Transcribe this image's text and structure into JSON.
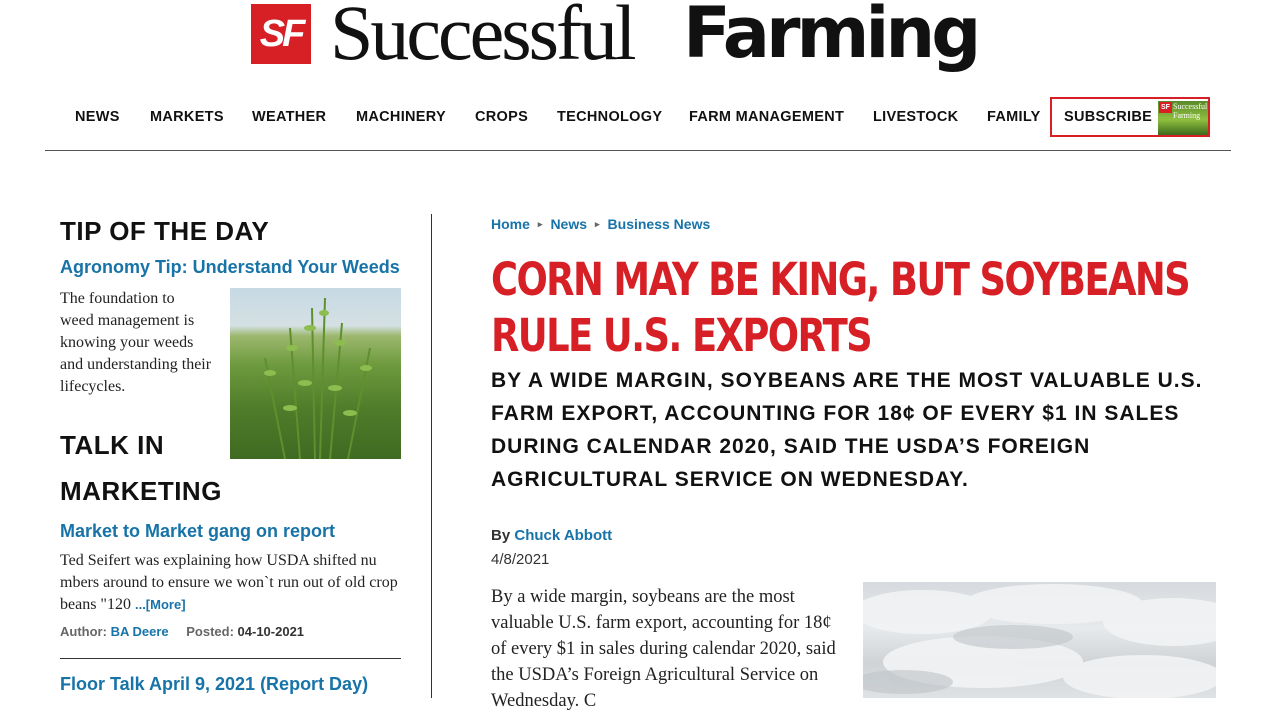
{
  "logo": {
    "badge": "SF",
    "word_light": "Successful",
    "word_bold": "Farming"
  },
  "nav": {
    "items": [
      "NEWS",
      "MARKETS",
      "WEATHER",
      "MACHINERY",
      "CROPS",
      "TECHNOLOGY",
      "FARM MANAGEMENT",
      "LIVESTOCK",
      "FAMILY"
    ],
    "subscribe": "SUBSCRIBE"
  },
  "sidebar": {
    "tip": {
      "heading": "TIP OF THE DAY",
      "link": "Agronomy Tip: Understand Your Weeds",
      "text": "The foundation to weed management is knowing your weeds and understanding their lifecycles."
    },
    "talk": {
      "heading_line1": "TALK IN",
      "heading_line2": "MARKETING",
      "link": "Market to Market gang on report",
      "text": "Ted Seifert was explaining how USDA shifted nu mbers around to ensure we won`t run out of old crop beans \"120 ",
      "more": "...[More]",
      "author_label": "Author:",
      "author": "BA Deere",
      "posted_label": "Posted:",
      "posted": "04-10-2021",
      "next_link": "Floor Talk April 9, 2021 (Report Day)"
    }
  },
  "article": {
    "breadcrumb": [
      "Home",
      "News",
      "Business News"
    ],
    "headline": "CORN MAY BE KING, BUT SOYBEANS RULE U.S. EXPORTS",
    "subhead": "BY A WIDE MARGIN, SOYBEANS ARE THE MOST VALUABLE U.S. FARM EXPORT, ACCOUNTING FOR 18¢ OF EVERY $1 IN SALES DURING CALENDAR 2020, SAID THE USDA’S FOREIGN AGRICULTURAL SERVICE ON WEDNESDAY.",
    "by_label": "By",
    "author": "Chuck Abbott",
    "date": "4/8/2021",
    "body": "By a wide margin, soybeans are the most valuable U.S. farm export, accounting for 18¢ of every $1 in sales during calendar 2020, said the USDA’s Foreign Agricultural Service on Wednesday. C"
  },
  "colors": {
    "brand_red": "#d71f26",
    "link_blue": "#1773a8"
  }
}
